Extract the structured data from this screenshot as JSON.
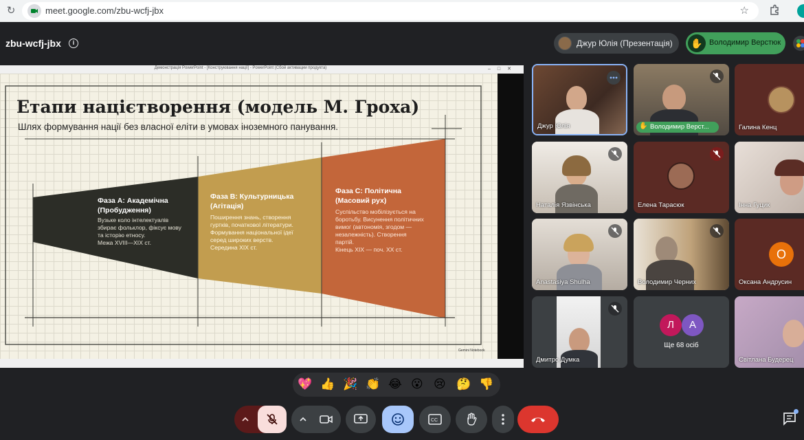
{
  "browser": {
    "url": "meet.google.com/zbu-wcfj-jbx"
  },
  "meeting": {
    "code": "zbu-wcfj-jbx",
    "presenter_chip": "Джур Юлія (Презентація)",
    "hand_raised_chip": "Володимир Верстюк"
  },
  "presentation": {
    "window_title": "Демонстрація PowerPoint - [Конструювання нації] - PowerPoint (Сбой активации продукта)",
    "slide": {
      "title": "Етапи націєтворення (модель М. Гроха)",
      "subtitle": "Шлях формування нації без власної еліти в умовах іноземного панування.",
      "phases": [
        {
          "title_l1": "Фаза А: Академічна",
          "title_l2": "(Пробудження)",
          "desc": [
            "Вузьке коло інтелектуалів",
            "збирає фольклор, фіксує мову",
            "та історію етносу.",
            "Межа XVIII—XIX ст."
          ],
          "color": "#2c2d27"
        },
        {
          "title_l1": "Фаза В: Культурницька",
          "title_l2": "(Агітація)",
          "desc": [
            "Поширення знань, створення",
            "гуртків, початкової літератури.",
            "Формування національної ідеї",
            "серед широких верств.",
            "Середина XIX ст."
          ],
          "color": "#c29d4f"
        },
        {
          "title_l1": "Фаза С: Політична",
          "title_l2": "(Масовий рух)",
          "desc": [
            "Суспільство мобілізується на",
            "боротьбу. Висунення політичних",
            "вимог (автономія, згодом —",
            "незалежність). Створення",
            "партій.",
            "Кінець XIX — поч. XX ст."
          ],
          "color": "#c3663a"
        }
      ],
      "watermark": "Gemini Notebook"
    }
  },
  "participants": [
    {
      "name": "Джур Юлія",
      "mic": "more"
    },
    {
      "name": "Володимир Верст...",
      "mic": "muted",
      "hand_raised": true
    },
    {
      "name": "Галина Кенц",
      "mic": "none"
    },
    {
      "name": "Наталія Язвінська",
      "mic": "muted"
    },
    {
      "name": "Елена Тарасюк",
      "mic": "muted-red"
    },
    {
      "name": "Інна Гуцик",
      "mic": "none"
    },
    {
      "name": "Anastasiya Shulha",
      "mic": "muted"
    },
    {
      "name": "Володимир Черних",
      "mic": "muted"
    },
    {
      "name": "Оксана Андрусин",
      "mic": "none",
      "initial": "О"
    },
    {
      "name": "Дмитро Думка",
      "mic": "muted"
    },
    {
      "name": "Ще 68 осіб",
      "initials": [
        "Л",
        "А"
      ]
    },
    {
      "name": "Світлана Будерец",
      "mic": "none"
    }
  ],
  "reactions": [
    "💖",
    "👍",
    "🎉",
    "👏",
    "😂",
    "😮",
    "😢",
    "🤔",
    "👎"
  ],
  "colors": {
    "end_call": "#ea4335",
    "muted_mic": "#f9dedc",
    "hand_chip": "#41a05b",
    "emoji_active": "#a8c7fa"
  }
}
